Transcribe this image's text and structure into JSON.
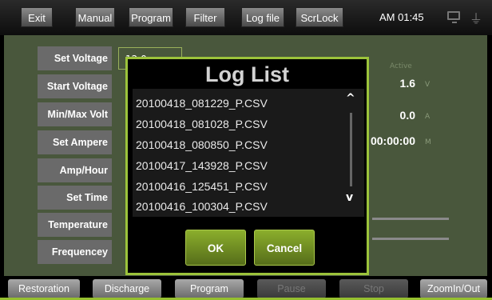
{
  "topbar": {
    "buttons": [
      "Exit",
      "Manual",
      "Program",
      "Filter",
      "Log file",
      "ScrLock"
    ],
    "clock": "AM 01:45",
    "icons": [
      "monitor-icon",
      "plug-icon"
    ]
  },
  "settings": {
    "labels": [
      "Set Voltage",
      "Start Voltage",
      "Min/Max Volt",
      "Set Ampere",
      "Amp/Hour",
      "Set Time",
      "Temperature",
      "Frequencey"
    ],
    "first_value": "12.0"
  },
  "status": {
    "header": "Active",
    "voltage": "1.6",
    "voltage_unit": "V",
    "ampere": "0.0",
    "ampere_unit": "A",
    "time": "00:00:00",
    "time_unit": "M"
  },
  "dialog": {
    "title": "Log List",
    "files": [
      "20100418_081229_P.CSV",
      "20100418_081028_P.CSV",
      "20100418_080850_P.CSV",
      "20100417_143928_P.CSV",
      "20100416_125451_P.CSV",
      "20100416_100304_P.CSV"
    ],
    "scroll_up": "^",
    "scroll_down": "v",
    "ok_label": "OK",
    "cancel_label": "Cancel"
  },
  "bottombar": {
    "buttons": [
      "Restoration",
      "Discharge",
      "Program",
      "Pause",
      "Stop",
      "ZoomIn/Out"
    ],
    "enabled": [
      true,
      true,
      true,
      false,
      false,
      true
    ]
  },
  "colors": {
    "accent": "#9cc33b",
    "panel": "#49573c"
  }
}
